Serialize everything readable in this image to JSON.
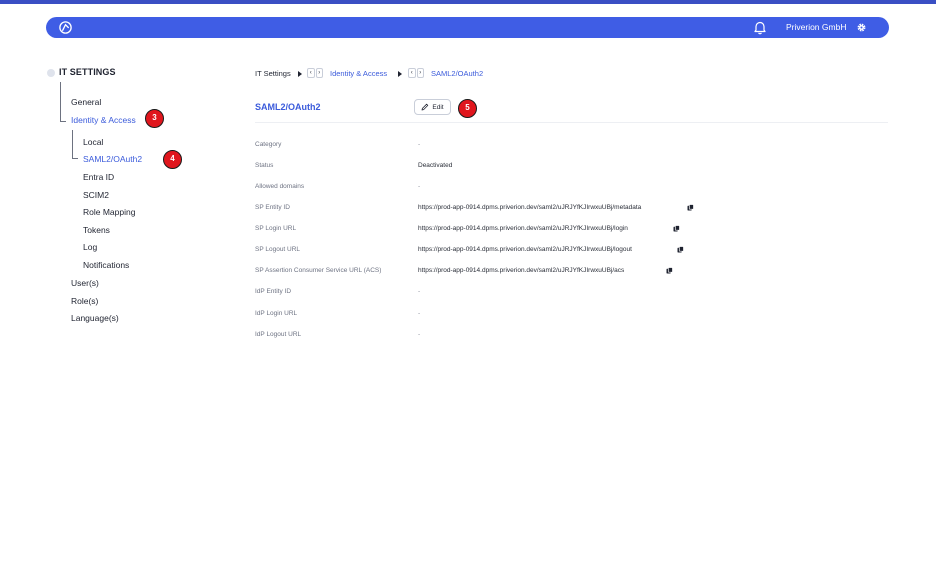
{
  "header": {
    "company": "Priverion GmbH",
    "brand_color": "#3f5de5"
  },
  "sidebar": {
    "title": "IT SETTINGS",
    "items": [
      {
        "label": "General"
      },
      {
        "label": "Identity & Access"
      },
      {
        "label": "Local"
      },
      {
        "label": "SAML2/OAuth2"
      },
      {
        "label": "Entra ID"
      },
      {
        "label": "SCIM2"
      },
      {
        "label": "Role Mapping"
      },
      {
        "label": "Tokens"
      },
      {
        "label": "Log"
      },
      {
        "label": "Notifications"
      },
      {
        "label": "User(s)"
      },
      {
        "label": "Role(s)"
      },
      {
        "label": "Language(s)"
      }
    ]
  },
  "breadcrumb": {
    "root": "IT Settings",
    "level1": "Identity & Access",
    "level2": "SAML2/OAuth2"
  },
  "page": {
    "title": "SAML2/OAuth2",
    "edit_label": "Edit"
  },
  "annotations": {
    "badge_3": "3",
    "badge_4": "4",
    "badge_5": "5",
    "badge_color": "#e0161d"
  },
  "details": [
    {
      "label": "Category",
      "value": "-"
    },
    {
      "label": "Status",
      "value": "Deactivated"
    },
    {
      "label": "Allowed domains",
      "value": "-"
    },
    {
      "label": "SP Entity ID",
      "value": "https://prod-app-0914.dpms.priverion.dev/saml2/uJRJYfKJIrwxuUBj/metadata"
    },
    {
      "label": "SP Login URL",
      "value": "https://prod-app-0914.dpms.priverion.dev/saml2/uJRJYfKJIrwxuUBj/login"
    },
    {
      "label": "SP Logout URL",
      "value": "https://prod-app-0914.dpms.priverion.dev/saml2/uJRJYfKJIrwxuUBj/logout"
    },
    {
      "label": "SP Assertion Consumer Service URL (ACS)",
      "value": "https://prod-app-0914.dpms.priverion.dev/saml2/uJRJYfKJIrwxuUBj/acs"
    },
    {
      "label": "IdP Entity ID",
      "value": "-"
    },
    {
      "label": "IdP Login URL",
      "value": "-"
    },
    {
      "label": "IdP Logout URL",
      "value": "-"
    }
  ],
  "icons": {
    "logo": "priverion-logo-icon",
    "notifications": "bell-icon",
    "settings": "gear-icon",
    "edit": "pencil-icon",
    "copy": "copy-icon"
  }
}
